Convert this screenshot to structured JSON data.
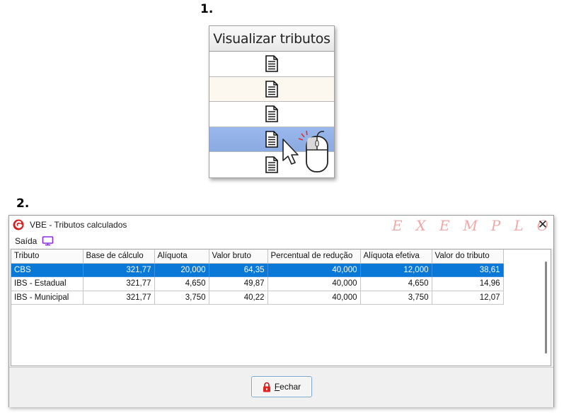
{
  "steps": {
    "step1": "1.",
    "step2": "2."
  },
  "column_panel": {
    "header": "Visualizar tributos",
    "rows": [
      {
        "icon": "document-icon",
        "state": "normal"
      },
      {
        "icon": "document-icon",
        "state": "alt"
      },
      {
        "icon": "document-icon",
        "state": "normal"
      },
      {
        "icon": "document-icon",
        "state": "selected"
      },
      {
        "icon": "document-icon",
        "state": "normal"
      }
    ],
    "cursor": "mouse-click-icon"
  },
  "window": {
    "title": "VBE - Tributos calculados",
    "watermark": "EXEMPLO",
    "close_glyph": "✕",
    "menu": {
      "saida_label": "Saída",
      "saida_icon": "monitor-icon"
    },
    "grid": {
      "headers": [
        "Tributo",
        "Base de cálculo",
        "Alíquota",
        "Valor bruto",
        "Percentual de redução",
        "Alíquota efetiva",
        "Valor do tributo"
      ],
      "rows": [
        [
          "CBS",
          "321,77",
          "20,000",
          "64,35",
          "40,000",
          "12,000",
          "38,61"
        ],
        [
          "IBS - Estadual",
          "321,77",
          "4,650",
          "49,87",
          "40,000",
          "4,650",
          "14,96"
        ],
        [
          "IBS - Municipal",
          "321,77",
          "3,750",
          "40,22",
          "40,000",
          "3,750",
          "12,07"
        ]
      ],
      "selected_row": 0
    },
    "footer": {
      "fechar_label": "Fechar",
      "fechar_icon": "lock-icon"
    }
  },
  "colors": {
    "selection": "#0a78d7",
    "row_selected_panel": "#9ab8ec",
    "watermark": "#f0a8a8",
    "accent_purple": "#8a2be2"
  }
}
